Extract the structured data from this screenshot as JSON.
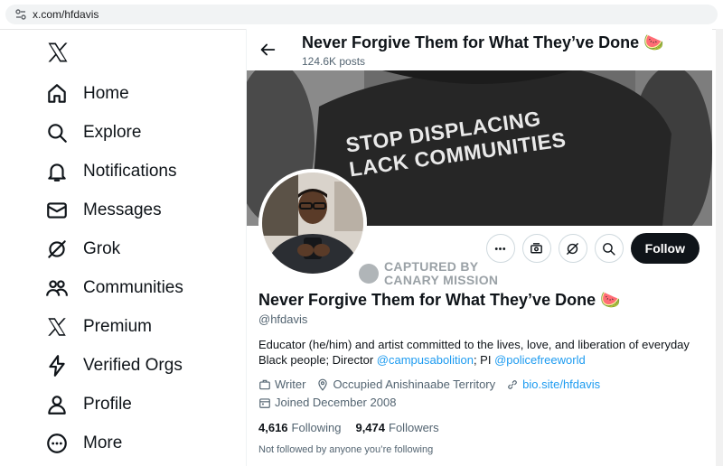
{
  "browser": {
    "url": "x.com/hfdavis"
  },
  "sidebar": {
    "items": [
      {
        "label": "Home",
        "icon": "home-icon"
      },
      {
        "label": "Explore",
        "icon": "search-icon"
      },
      {
        "label": "Notifications",
        "icon": "bell-icon"
      },
      {
        "label": "Messages",
        "icon": "envelope-icon"
      },
      {
        "label": "Grok",
        "icon": "grok-icon"
      },
      {
        "label": "Communities",
        "icon": "people-icon"
      },
      {
        "label": "Premium",
        "icon": "x-logo-icon"
      },
      {
        "label": "Verified Orgs",
        "icon": "lightning-icon"
      },
      {
        "label": "Profile",
        "icon": "person-icon"
      },
      {
        "label": "More",
        "icon": "more-circle-icon"
      }
    ]
  },
  "header": {
    "title": "Never Forgive Them for What They’ve Done 🍉",
    "posts": "124.6K posts"
  },
  "banner": {
    "shirt_text_line1": "STOP DISPLACING",
    "shirt_text_line2": "LACK COMMUNITIES"
  },
  "watermark": {
    "line1": "CAPTURED BY",
    "line2": "CANARY MISSION"
  },
  "actions": {
    "follow_label": "Follow"
  },
  "profile": {
    "name": "Never Forgive Them for What They’ve Done 🍉",
    "handle": "@hfdavis",
    "bio_text": "Educator (he/him) and artist committed to the lives, love, and liberation of everyday Black people; Director ",
    "bio_link1": "@campusabolition",
    "bio_mid": "; PI ",
    "bio_link2": "@policefreeworld",
    "profession": "Writer",
    "location": "Occupied Anishinaabe Territory",
    "website": "bio.site/hfdavis",
    "joined": "Joined December 2008",
    "following_count": "4,616",
    "following_label": "Following",
    "followers_count": "9,474",
    "followers_label": "Followers",
    "not_followed": "Not followed by anyone you’re following"
  },
  "colors": {
    "accent": "#1d9bf0",
    "text": "#0f1419",
    "muted": "#536471"
  }
}
